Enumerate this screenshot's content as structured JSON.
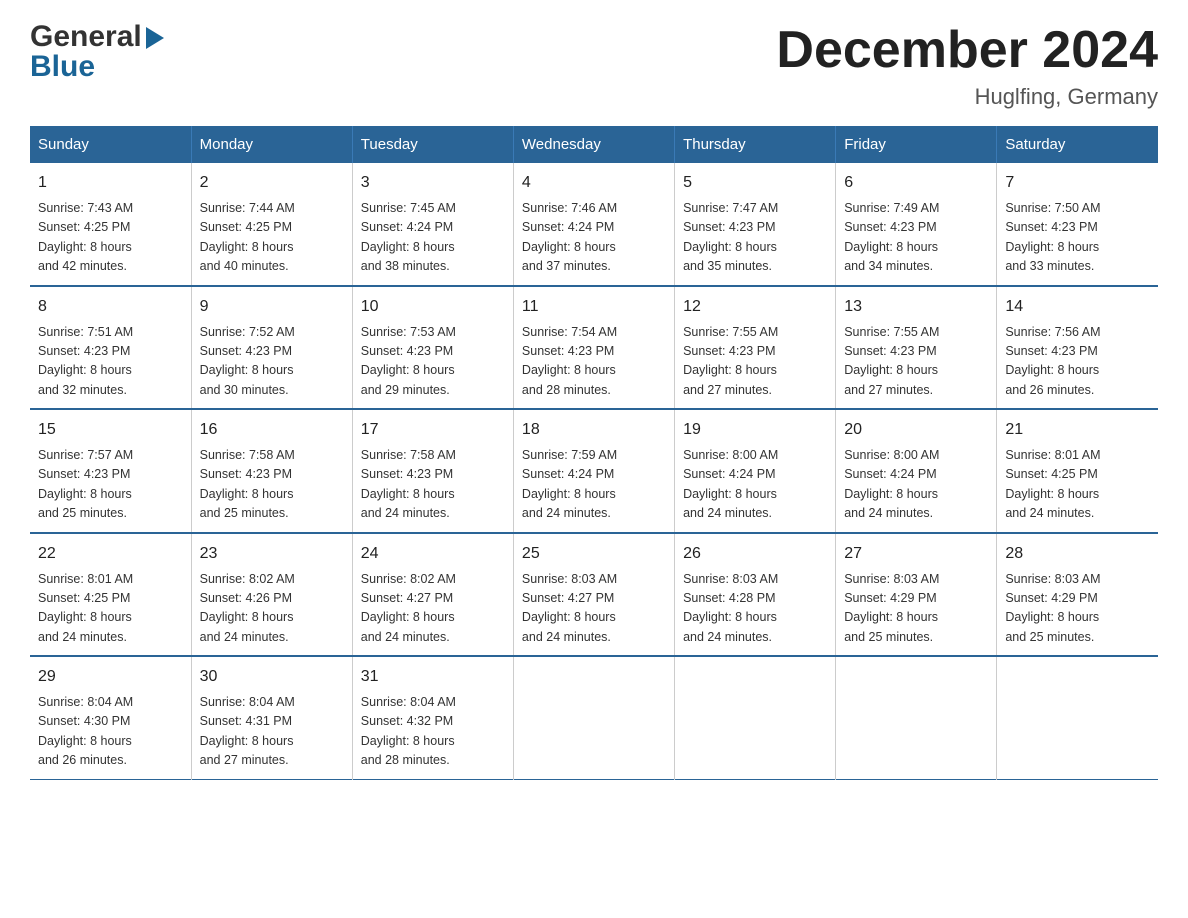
{
  "logo": {
    "general": "General",
    "blue": "Blue",
    "arrow": "▶"
  },
  "title": "December 2024",
  "subtitle": "Huglfing, Germany",
  "days_of_week": [
    "Sunday",
    "Monday",
    "Tuesday",
    "Wednesday",
    "Thursday",
    "Friday",
    "Saturday"
  ],
  "weeks": [
    [
      {
        "day": "1",
        "info": "Sunrise: 7:43 AM\nSunset: 4:25 PM\nDaylight: 8 hours\nand 42 minutes."
      },
      {
        "day": "2",
        "info": "Sunrise: 7:44 AM\nSunset: 4:25 PM\nDaylight: 8 hours\nand 40 minutes."
      },
      {
        "day": "3",
        "info": "Sunrise: 7:45 AM\nSunset: 4:24 PM\nDaylight: 8 hours\nand 38 minutes."
      },
      {
        "day": "4",
        "info": "Sunrise: 7:46 AM\nSunset: 4:24 PM\nDaylight: 8 hours\nand 37 minutes."
      },
      {
        "day": "5",
        "info": "Sunrise: 7:47 AM\nSunset: 4:23 PM\nDaylight: 8 hours\nand 35 minutes."
      },
      {
        "day": "6",
        "info": "Sunrise: 7:49 AM\nSunset: 4:23 PM\nDaylight: 8 hours\nand 34 minutes."
      },
      {
        "day": "7",
        "info": "Sunrise: 7:50 AM\nSunset: 4:23 PM\nDaylight: 8 hours\nand 33 minutes."
      }
    ],
    [
      {
        "day": "8",
        "info": "Sunrise: 7:51 AM\nSunset: 4:23 PM\nDaylight: 8 hours\nand 32 minutes."
      },
      {
        "day": "9",
        "info": "Sunrise: 7:52 AM\nSunset: 4:23 PM\nDaylight: 8 hours\nand 30 minutes."
      },
      {
        "day": "10",
        "info": "Sunrise: 7:53 AM\nSunset: 4:23 PM\nDaylight: 8 hours\nand 29 minutes."
      },
      {
        "day": "11",
        "info": "Sunrise: 7:54 AM\nSunset: 4:23 PM\nDaylight: 8 hours\nand 28 minutes."
      },
      {
        "day": "12",
        "info": "Sunrise: 7:55 AM\nSunset: 4:23 PM\nDaylight: 8 hours\nand 27 minutes."
      },
      {
        "day": "13",
        "info": "Sunrise: 7:55 AM\nSunset: 4:23 PM\nDaylight: 8 hours\nand 27 minutes."
      },
      {
        "day": "14",
        "info": "Sunrise: 7:56 AM\nSunset: 4:23 PM\nDaylight: 8 hours\nand 26 minutes."
      }
    ],
    [
      {
        "day": "15",
        "info": "Sunrise: 7:57 AM\nSunset: 4:23 PM\nDaylight: 8 hours\nand 25 minutes."
      },
      {
        "day": "16",
        "info": "Sunrise: 7:58 AM\nSunset: 4:23 PM\nDaylight: 8 hours\nand 25 minutes."
      },
      {
        "day": "17",
        "info": "Sunrise: 7:58 AM\nSunset: 4:23 PM\nDaylight: 8 hours\nand 24 minutes."
      },
      {
        "day": "18",
        "info": "Sunrise: 7:59 AM\nSunset: 4:24 PM\nDaylight: 8 hours\nand 24 minutes."
      },
      {
        "day": "19",
        "info": "Sunrise: 8:00 AM\nSunset: 4:24 PM\nDaylight: 8 hours\nand 24 minutes."
      },
      {
        "day": "20",
        "info": "Sunrise: 8:00 AM\nSunset: 4:24 PM\nDaylight: 8 hours\nand 24 minutes."
      },
      {
        "day": "21",
        "info": "Sunrise: 8:01 AM\nSunset: 4:25 PM\nDaylight: 8 hours\nand 24 minutes."
      }
    ],
    [
      {
        "day": "22",
        "info": "Sunrise: 8:01 AM\nSunset: 4:25 PM\nDaylight: 8 hours\nand 24 minutes."
      },
      {
        "day": "23",
        "info": "Sunrise: 8:02 AM\nSunset: 4:26 PM\nDaylight: 8 hours\nand 24 minutes."
      },
      {
        "day": "24",
        "info": "Sunrise: 8:02 AM\nSunset: 4:27 PM\nDaylight: 8 hours\nand 24 minutes."
      },
      {
        "day": "25",
        "info": "Sunrise: 8:03 AM\nSunset: 4:27 PM\nDaylight: 8 hours\nand 24 minutes."
      },
      {
        "day": "26",
        "info": "Sunrise: 8:03 AM\nSunset: 4:28 PM\nDaylight: 8 hours\nand 24 minutes."
      },
      {
        "day": "27",
        "info": "Sunrise: 8:03 AM\nSunset: 4:29 PM\nDaylight: 8 hours\nand 25 minutes."
      },
      {
        "day": "28",
        "info": "Sunrise: 8:03 AM\nSunset: 4:29 PM\nDaylight: 8 hours\nand 25 minutes."
      }
    ],
    [
      {
        "day": "29",
        "info": "Sunrise: 8:04 AM\nSunset: 4:30 PM\nDaylight: 8 hours\nand 26 minutes."
      },
      {
        "day": "30",
        "info": "Sunrise: 8:04 AM\nSunset: 4:31 PM\nDaylight: 8 hours\nand 27 minutes."
      },
      {
        "day": "31",
        "info": "Sunrise: 8:04 AM\nSunset: 4:32 PM\nDaylight: 8 hours\nand 28 minutes."
      },
      {
        "day": "",
        "info": ""
      },
      {
        "day": "",
        "info": ""
      },
      {
        "day": "",
        "info": ""
      },
      {
        "day": "",
        "info": ""
      }
    ]
  ]
}
